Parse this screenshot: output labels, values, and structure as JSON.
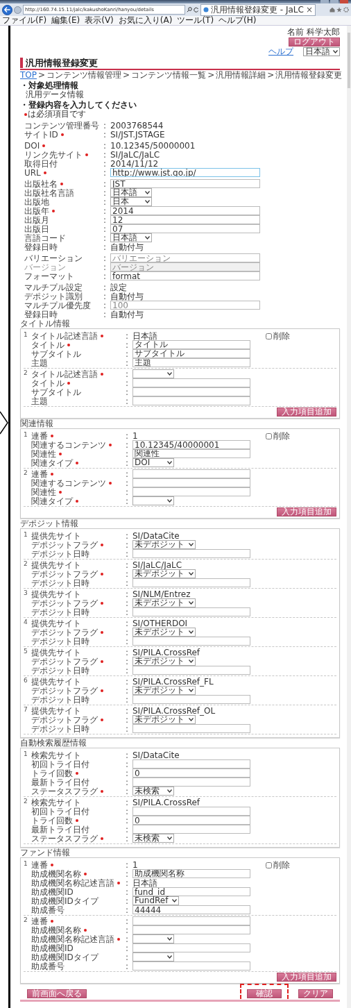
{
  "browser": {
    "url": "http://160.74.15.11/jalc/kakushoKanri/hanyou/details",
    "tab_title": "汎用情報登録変更 - JaLC",
    "tab_close": "×",
    "menu": [
      "ファイル(F)",
      "編集(E)",
      "表示(V)",
      "お気に入り(A)",
      "ツール(T)",
      "ヘルプ(H)"
    ]
  },
  "header": {
    "user_name": "名前 科学太郎",
    "logout": "ログアウト",
    "help": "ヘルプ",
    "language": "日本語"
  },
  "page_title": "汎用情報登録変更",
  "breadcrumb": [
    {
      "label": "TOP",
      "link": true
    },
    {
      "label": "コンテンツ情報管理",
      "link": false
    },
    {
      "label": "コンテンツ情報一覧",
      "link": false
    },
    {
      "label": "汎用情報詳細",
      "link": false
    },
    {
      "label": "汎用情報登録変更",
      "link": false
    }
  ],
  "breadcrumb_separator": ">",
  "field_separator": ":",
  "target_heading": "・対象処理情報",
  "target_value": "汎用データ情報",
  "input_heading": "・登録内容を入力してください",
  "required_note": "は必須項目です",
  "form_groups": [
    {
      "fields": [
        {
          "kind": "text",
          "label": "コンテンツ管理番号",
          "required": false,
          "value": "2003768544"
        },
        {
          "kind": "text",
          "label": "サイトID",
          "required": true,
          "value": "SI/JST.JSTAGE"
        }
      ]
    },
    {
      "fields": [
        {
          "kind": "text",
          "label": "DOI",
          "required": true,
          "value": "10.12345/50000001"
        },
        {
          "kind": "text",
          "label": "リンク先サイト",
          "required": true,
          "value": "SI/JaLC/JaLC"
        },
        {
          "kind": "text",
          "label": "取得日付",
          "required": false,
          "value": "2014/11/12"
        },
        {
          "kind": "input",
          "label": "URL",
          "required": true,
          "value": "http://www.jst.go.jp/",
          "focused": true
        }
      ]
    },
    {
      "fields": [
        {
          "kind": "input",
          "label": "出版社名",
          "required": true,
          "value": "JST"
        },
        {
          "kind": "select",
          "label": "出版社名言語",
          "required": false,
          "value": "日本語"
        },
        {
          "kind": "select",
          "label": "出版地",
          "required": false,
          "value": "日本"
        },
        {
          "kind": "input",
          "label": "出版年",
          "required": true,
          "value": "2014"
        },
        {
          "kind": "input",
          "label": "出版月",
          "required": false,
          "value": "12"
        },
        {
          "kind": "input",
          "label": "出版日",
          "required": false,
          "value": "07"
        },
        {
          "kind": "select",
          "label": "言語コード",
          "required": false,
          "value": "日本語"
        },
        {
          "kind": "text",
          "label": "登録日時",
          "required": false,
          "value": "自動付与"
        }
      ]
    },
    {
      "fields": [
        {
          "kind": "input",
          "label": "バリエーション",
          "required": false,
          "placeholder": "バリエーション",
          "disabled": false
        },
        {
          "kind": "input",
          "label": "バージョン",
          "required": false,
          "placeholder": "バージョン",
          "disabled": true
        },
        {
          "kind": "input",
          "label": "フォーマット",
          "required": false,
          "value": "format",
          "disabled": false
        }
      ]
    },
    {
      "fields": [
        {
          "kind": "text",
          "label": "マルチプル設定",
          "required": false,
          "value": "設定"
        },
        {
          "kind": "text",
          "label": "デポジット識別",
          "required": false,
          "value": "自動付与"
        },
        {
          "kind": "input",
          "label": "マルチプル優先度",
          "required": false,
          "placeholder": "100"
        },
        {
          "kind": "text",
          "label": "登録日時",
          "required": false,
          "value": "自動付与"
        }
      ]
    }
  ],
  "panels": [
    {
      "title": "タイトル情報",
      "add_button": "入力項目追加",
      "entries": [
        {
          "no": "1",
          "delete": {
            "label": "削除",
            "checked": false
          },
          "fields": [
            {
              "kind": "text",
              "label": "タイトル記述言語",
              "required": true,
              "value": "日本語"
            },
            {
              "kind": "input",
              "label": "タイトル",
              "required": true,
              "value": "タイトル"
            },
            {
              "kind": "input",
              "label": "サブタイトル",
              "required": false,
              "value": "サブタイトル"
            },
            {
              "kind": "input",
              "label": "主題",
              "required": false,
              "value": "主題"
            }
          ]
        },
        {
          "no": "2",
          "fields": [
            {
              "kind": "select",
              "label": "タイトル記述言語",
              "required": true
            },
            {
              "kind": "input",
              "label": "タイトル",
              "required": true
            },
            {
              "kind": "input",
              "label": "サブタイトル",
              "required": false
            },
            {
              "kind": "input",
              "label": "主題",
              "required": false
            }
          ]
        }
      ]
    },
    {
      "title": "関連情報",
      "add_button": "入力項目追加",
      "entries": [
        {
          "no": "1",
          "delete": {
            "label": "削除",
            "checked": false
          },
          "fields": [
            {
              "kind": "text",
              "label": "連番",
              "required": true,
              "value": "1"
            },
            {
              "kind": "input",
              "label": "関連するコンテンツ",
              "required": true,
              "value": "10.12345/40000001"
            },
            {
              "kind": "input",
              "label": "関連性",
              "required": true,
              "value": "関連性"
            },
            {
              "kind": "select",
              "label": "関連タイプ",
              "required": true,
              "value": "DOI"
            }
          ]
        },
        {
          "no": "2",
          "fields": [
            {
              "kind": "input",
              "label": "連番",
              "required": true
            },
            {
              "kind": "input",
              "label": "関連するコンテンツ",
              "required": true
            },
            {
              "kind": "input",
              "label": "関連性",
              "required": true
            },
            {
              "kind": "select",
              "label": "関連タイプ",
              "required": true
            }
          ]
        }
      ]
    },
    {
      "title": "デポジット情報",
      "entries": [
        {
          "no": "1",
          "fields": [
            {
              "kind": "text",
              "label": "提供先サイト",
              "required": false,
              "value": "SI/DataCite"
            },
            {
              "kind": "select",
              "label": "デポジットフラグ",
              "required": true,
              "value": "未デポジット"
            },
            {
              "kind": "input",
              "label": "デポジット日時",
              "required": false
            }
          ]
        },
        {
          "no": "2",
          "fields": [
            {
              "kind": "text",
              "label": "提供先サイト",
              "required": false,
              "value": "SI/JaLC/JaLC"
            },
            {
              "kind": "select",
              "label": "デポジットフラグ",
              "required": true,
              "value": "未デポジット"
            },
            {
              "kind": "input",
              "label": "デポジット日時",
              "required": false
            }
          ]
        },
        {
          "no": "3",
          "fields": [
            {
              "kind": "text",
              "label": "提供先サイト",
              "required": false,
              "value": "SI/NLM/Entrez"
            },
            {
              "kind": "select",
              "label": "デポジットフラグ",
              "required": true,
              "value": "未デポジット"
            },
            {
              "kind": "input",
              "label": "デポジット日時",
              "required": false
            }
          ]
        },
        {
          "no": "4",
          "fields": [
            {
              "kind": "text",
              "label": "提供先サイト",
              "required": false,
              "value": "SI/OTHERDOI"
            },
            {
              "kind": "select",
              "label": "デポジットフラグ",
              "required": true,
              "value": "未デポジット"
            },
            {
              "kind": "input",
              "label": "デポジット日時",
              "required": false
            }
          ]
        },
        {
          "no": "5",
          "fields": [
            {
              "kind": "text",
              "label": "提供先サイト",
              "required": false,
              "value": "SI/PILA.CrossRef"
            },
            {
              "kind": "select",
              "label": "デポジットフラグ",
              "required": true,
              "value": "未デポジット"
            },
            {
              "kind": "input",
              "label": "デポジット日時",
              "required": false
            }
          ]
        },
        {
          "no": "6",
          "fields": [
            {
              "kind": "text",
              "label": "提供先サイト",
              "required": false,
              "value": "SI/PILA.CrossRef_FL"
            },
            {
              "kind": "select",
              "label": "デポジットフラグ",
              "required": true,
              "value": "未デポジット"
            },
            {
              "kind": "input",
              "label": "デポジット日時",
              "required": false
            }
          ]
        },
        {
          "no": "7",
          "fields": [
            {
              "kind": "text",
              "label": "提供先サイト",
              "required": false,
              "value": "SI/PILA.CrossRef_OL"
            },
            {
              "kind": "select",
              "label": "デポジットフラグ",
              "required": true,
              "value": "未デポジット"
            },
            {
              "kind": "input",
              "label": "デポジット日時",
              "required": false
            }
          ]
        }
      ]
    },
    {
      "title": "自動検索履歴情報",
      "entries": [
        {
          "no": "1",
          "fields": [
            {
              "kind": "text",
              "label": "検索先サイト",
              "required": false,
              "value": "SI/DataCite"
            },
            {
              "kind": "input",
              "label": "初回トライ日付",
              "required": false
            },
            {
              "kind": "input",
              "label": "トライ回数",
              "required": true,
              "value": "0"
            },
            {
              "kind": "input",
              "label": "最新トライ日付",
              "required": false
            },
            {
              "kind": "select",
              "label": "ステータスフラグ",
              "required": true,
              "value": "未検索"
            }
          ]
        },
        {
          "no": "2",
          "fields": [
            {
              "kind": "text",
              "label": "検索先サイト",
              "required": false,
              "value": "SI/PILA.CrossRef"
            },
            {
              "kind": "input",
              "label": "初回トライ日付",
              "required": false
            },
            {
              "kind": "input",
              "label": "トライ回数",
              "required": true,
              "value": "0"
            },
            {
              "kind": "input",
              "label": "最新トライ日付",
              "required": false
            },
            {
              "kind": "select",
              "label": "ステータスフラグ",
              "required": true,
              "value": "未検索"
            }
          ]
        }
      ]
    },
    {
      "title": "ファンド情報",
      "add_button": "入力項目追加",
      "entries": [
        {
          "no": "1",
          "delete": {
            "label": "削除",
            "checked": false
          },
          "fields": [
            {
              "kind": "text",
              "label": "連番",
              "required": true,
              "value": "1"
            },
            {
              "kind": "input",
              "label": "助成機関名称",
              "required": true,
              "value": "助成機関名称"
            },
            {
              "kind": "text",
              "label": "助成機関名称記述言語",
              "required": true,
              "value": "日本語"
            },
            {
              "kind": "input",
              "label": "助成機関ID",
              "required": false,
              "value": "fund_id"
            },
            {
              "kind": "select",
              "label": "助成機関IDタイプ",
              "required": false,
              "value": "FundRef"
            },
            {
              "kind": "input",
              "label": "助成番号",
              "required": false,
              "value": "44444"
            }
          ]
        },
        {
          "no": "2",
          "fields": [
            {
              "kind": "input",
              "label": "連番",
              "required": true
            },
            {
              "kind": "input",
              "label": "助成機関名称",
              "required": true
            },
            {
              "kind": "select",
              "label": "助成機関名称記述言語",
              "required": true
            },
            {
              "kind": "input",
              "label": "助成機関ID",
              "required": false
            },
            {
              "kind": "select",
              "label": "助成機関IDタイプ",
              "required": false
            },
            {
              "kind": "input",
              "label": "助成番号",
              "required": false
            }
          ]
        }
      ]
    }
  ],
  "footer_buttons": [
    {
      "label": "前画面へ戻る",
      "highlighted": false
    },
    {
      "label": "確認",
      "highlighted": true
    },
    {
      "label": "クリア",
      "highlighted": false
    }
  ]
}
